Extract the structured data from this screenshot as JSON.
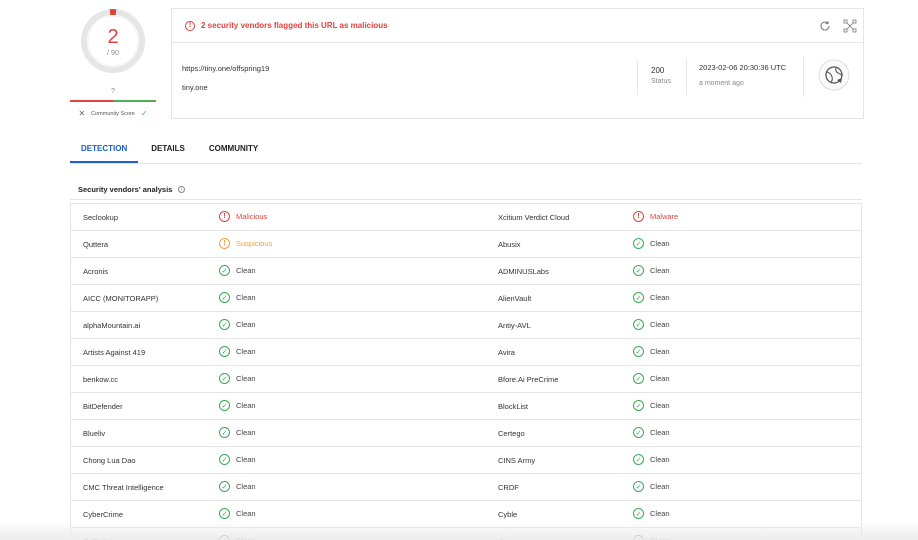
{
  "score": {
    "detections": "2",
    "total": "/ 90",
    "community_value": "?",
    "community_label": "Community Score",
    "malicious_fraction": 0.5
  },
  "alert": {
    "text": "2 security vendors flagged this URL as malicious"
  },
  "url_info": {
    "url": "https://tiny.one/offspring19",
    "domain": "tiny.one",
    "status_code": "200",
    "status_label": "Status",
    "date": "2023-02-06 20:30:36 UTC",
    "date_ago": "a moment ago"
  },
  "tabs": [
    {
      "label": "DETECTION"
    },
    {
      "label": "DETAILS"
    },
    {
      "label": "COMMUNITY"
    }
  ],
  "section": {
    "title": "Security vendors' analysis"
  },
  "vendors": [
    {
      "left_name": "Seclookup",
      "left_verdict": "Malicious",
      "left_type": "mal",
      "right_name": "Xcitium Verdict Cloud",
      "right_verdict": "Malware",
      "right_type": "mal"
    },
    {
      "left_name": "Quttera",
      "left_verdict": "Suspicious",
      "left_type": "sus",
      "right_name": "Abusix",
      "right_verdict": "Clean",
      "right_type": "clean"
    },
    {
      "left_name": "Acronis",
      "left_verdict": "Clean",
      "left_type": "clean",
      "right_name": "ADMINUSLabs",
      "right_verdict": "Clean",
      "right_type": "clean"
    },
    {
      "left_name": "AICC (MONITORAPP)",
      "left_verdict": "Clean",
      "left_type": "clean",
      "right_name": "AlienVault",
      "right_verdict": "Clean",
      "right_type": "clean"
    },
    {
      "left_name": "alphaMountain.ai",
      "left_verdict": "Clean",
      "left_type": "clean",
      "right_name": "Antiy-AVL",
      "right_verdict": "Clean",
      "right_type": "clean"
    },
    {
      "left_name": "Artists Against 419",
      "left_verdict": "Clean",
      "left_type": "clean",
      "right_name": "Avira",
      "right_verdict": "Clean",
      "right_type": "clean"
    },
    {
      "left_name": "benkow.cc",
      "left_verdict": "Clean",
      "left_type": "clean",
      "right_name": "Bfore.Ai PreCrime",
      "right_verdict": "Clean",
      "right_type": "clean"
    },
    {
      "left_name": "BitDefender",
      "left_verdict": "Clean",
      "left_type": "clean",
      "right_name": "BlockList",
      "right_verdict": "Clean",
      "right_type": "clean"
    },
    {
      "left_name": "Blueliv",
      "left_verdict": "Clean",
      "left_type": "clean",
      "right_name": "Certego",
      "right_verdict": "Clean",
      "right_type": "clean"
    },
    {
      "left_name": "Chong Lua Dao",
      "left_verdict": "Clean",
      "left_type": "clean",
      "right_name": "CINS Army",
      "right_verdict": "Clean",
      "right_type": "clean"
    },
    {
      "left_name": "CMC Threat Intelligence",
      "left_verdict": "Clean",
      "left_type": "clean",
      "right_name": "CRDF",
      "right_verdict": "Clean",
      "right_type": "clean"
    },
    {
      "left_name": "CyberCrime",
      "left_verdict": "Clean",
      "left_type": "clean",
      "right_name": "Cyble",
      "right_verdict": "Clean",
      "right_type": "clean"
    },
    {
      "left_name": "CyRadar",
      "left_verdict": "Clean",
      "left_type": "clean",
      "right_name": "desenmascara.me",
      "right_verdict": "Clean",
      "right_type": "clean"
    }
  ],
  "colors": {
    "malicious": "#e0433c",
    "suspicious": "#f0a14a",
    "clean": "#3aa856",
    "accent": "#1a5fcb"
  }
}
